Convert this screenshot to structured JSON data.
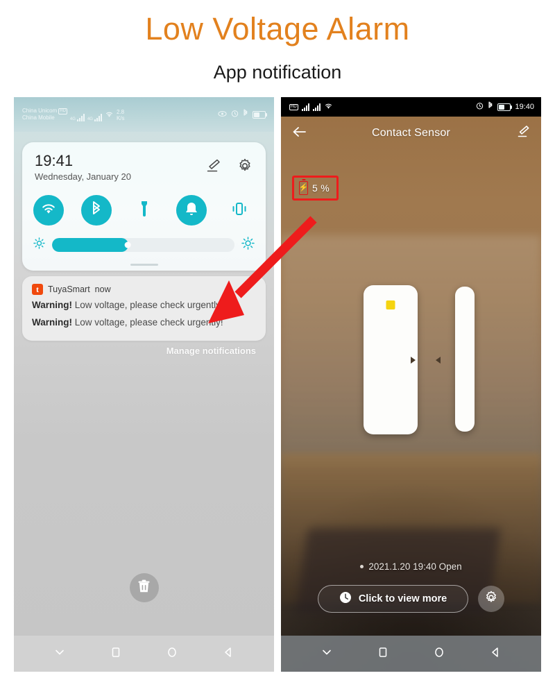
{
  "header": {
    "title": "Low Voltage Alarm",
    "subtitle": "App notification",
    "title_color": "#e2811e"
  },
  "left_phone": {
    "status_bar": {
      "carrier_primary": "China Unicom",
      "carrier_hd_badge": "HD",
      "carrier_secondary": "China Mobile",
      "network_type_1": "4G",
      "network_type_2": "4G",
      "net_speed": "2.8",
      "net_speed_unit": "K/s",
      "icons": [
        "eye-comfort-icon",
        "alarm-icon",
        "bluetooth-icon",
        "battery-icon"
      ]
    },
    "quick_settings": {
      "time": "19:41",
      "date": "Wednesday, January 20",
      "edit_icon": "pencil-icon",
      "settings_icon": "gear-icon",
      "toggles": [
        {
          "name": "wifi",
          "icon": "wifi-icon",
          "state": "on"
        },
        {
          "name": "bluetooth",
          "icon": "bluetooth-icon",
          "state": "on"
        },
        {
          "name": "flashlight",
          "icon": "flashlight-icon",
          "state": "off"
        },
        {
          "name": "sound",
          "icon": "bell-icon",
          "state": "on"
        },
        {
          "name": "vibrate",
          "icon": "vibrate-icon",
          "state": "off"
        }
      ],
      "brightness_percent": 42,
      "brightness_low_icon": "brightness-low-icon",
      "brightness_high_icon": "brightness-high-icon",
      "accent_color": "#14b8c8"
    },
    "notification": {
      "app_icon": "tuyasmart-icon",
      "app_icon_letter": "t",
      "app_name": "TuyaSmart",
      "timestamp": "now",
      "line1_bold": "Warning!",
      "line1_rest": " Low voltage, please check urgently!",
      "line2_bold": "Warning!",
      "line2_rest": " Low voltage, please check urgently!"
    },
    "manage_notifications": "Manage notifications",
    "clear_all_icon": "trash-icon",
    "nav_bar": [
      "chevron-down-icon",
      "recents-square-icon",
      "home-circle-icon",
      "back-triangle-icon"
    ]
  },
  "right_phone": {
    "status_bar": {
      "time": "19:40",
      "left_icons": [
        "hd-icon",
        "signal-1-icon",
        "signal-2-icon",
        "wifi-icon"
      ],
      "right_icons": [
        "alarm-icon",
        "bluetooth-icon",
        "battery-icon"
      ]
    },
    "app_bar": {
      "back_icon": "back-arrow-icon",
      "title": "Contact Sensor",
      "edit_icon": "pencil-icon"
    },
    "battery_badge": {
      "icon": "battery-low-icon",
      "value": "5 %",
      "highlight_color": "#ee1c1c"
    },
    "device": {
      "name": "contact-sensor-graphic",
      "led_color": "#f5d410"
    },
    "status_line": "2021.1.20 19:40 Open",
    "view_more_button": {
      "icon": "clock-icon",
      "label": "Click to view more"
    },
    "settings_button_icon": "gear-icon",
    "nav_bar": [
      "chevron-down-icon",
      "recents-square-icon",
      "home-circle-icon",
      "back-triangle-icon"
    ]
  },
  "annotation": {
    "arrow_color": "#ee1c1c",
    "arrow_name": "red-pointer-arrow"
  }
}
